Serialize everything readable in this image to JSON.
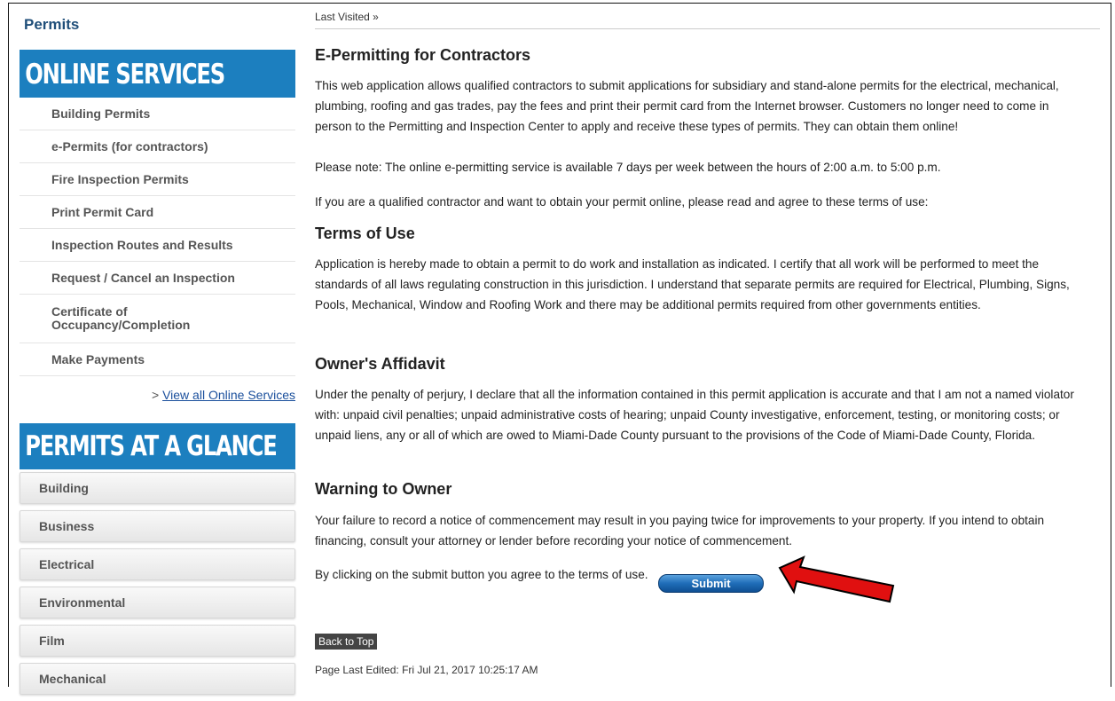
{
  "sidebar": {
    "title": "Permits",
    "online_services": {
      "heading": "ONLINE SERVICES",
      "items": [
        "Building Permits",
        "e-Permits (for contractors)",
        "Fire Inspection Permits",
        "Print Permit Card",
        "Inspection Routes and Results",
        "Request / Cancel an Inspection",
        "Certificate of",
        "Occupancy/Completion",
        "Make Payments"
      ],
      "view_all_prefix": "> ",
      "view_all_link": "View all Online Services"
    },
    "glance": {
      "heading": "PERMITS AT A GLANCE",
      "items": [
        "Building",
        "Business",
        "Electrical",
        "Environmental",
        "Film",
        "Mechanical"
      ]
    }
  },
  "main": {
    "breadcrumb": "Last Visited »",
    "title": "E-Permitting for Contractors",
    "intro": "This web application allows qualified contractors to submit applications for subsidiary and stand-alone permits for the electrical, mechanical, plumbing, roofing and gas trades, pay the fees and print their permit card from the Internet browser. Customers no longer need to come in person to the Permitting and Inspection Center to apply and receive these types of permits. They can obtain them online!",
    "note": "Please note: The online e-permitting service is available 7 days per week between the hours of 2:00 a.m. to 5:00 p.m.",
    "agree_prompt": "If you are a qualified contractor and want to obtain your permit online, please read and agree to these terms of use:",
    "terms_heading": "Terms of Use",
    "terms_text": "Application is hereby made to obtain a permit to do work and installation as indicated. I certify that all work will be performed to meet the standards of all laws regulating construction in this jurisdiction. I understand that separate permits are required for Electrical, Plumbing, Signs, Pools, Mechanical, Window and Roofing Work and there may be additional permits required from other governments entities.",
    "affidavit_heading": "Owner's Affidavit",
    "affidavit_text": "Under the penalty of perjury, I declare that all the information contained in this permit application is accurate and that I am not a named violator with: unpaid civil penalties; unpaid administrative costs of hearing; unpaid County investigative, enforcement, testing, or monitoring costs; or unpaid liens, any or all of which are owed to Miami-Dade County pursuant to the provisions of the Code of Miami-Dade County, Florida.",
    "warning_heading": "Warning to Owner",
    "warning_text": "Your failure to record a notice of commencement may result in you paying twice for improvements to your property. If you intend to obtain financing, consult your attorney or lender before recording your notice of commencement.",
    "submit_note": "By clicking on the submit button you agree to the terms of use.",
    "submit_label": "Submit",
    "back_to_top": "Back to Top",
    "last_edited": "Page Last Edited: Fri Jul 21, 2017 10:25:17 AM"
  },
  "colors": {
    "band": "#1c7fbf",
    "title": "#1f4e79",
    "link": "#1a4f9c",
    "arrow": "#e01010"
  }
}
